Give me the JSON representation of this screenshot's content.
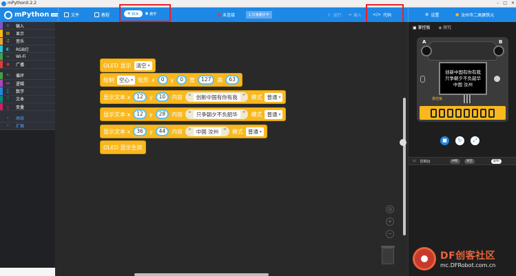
{
  "window": {
    "title": "mPython0.2.2",
    "controls": [
      "–",
      "□",
      "✕"
    ]
  },
  "toolbar": {
    "app_name": "mPython",
    "app_tag": "beta",
    "file": "文件",
    "tutorial": "教程",
    "mode_blocks": "积木",
    "mode_teach": "教学",
    "status": "未连接",
    "device": "1.只争朝夕不",
    "run": "运行",
    "import": "插入",
    "code": "代码",
    "settings": "设置",
    "account": "汝州市二高建筑元"
  },
  "sidebar": {
    "categories": [
      {
        "label": "输入",
        "color": "#7e57c2",
        "icon": "⊕"
      },
      {
        "label": "显示",
        "color": "#f9b81d",
        "icon": "▤"
      },
      {
        "label": "音乐",
        "color": "#e9a23b",
        "icon": "♫"
      },
      {
        "label": "RGB灯",
        "color": "#26c6da",
        "icon": "◐"
      },
      {
        "label": "Wi-Fi",
        "color": "#43a047",
        "icon": "≈"
      },
      {
        "label": "广播",
        "color": "#e53935",
        "icon": "◉"
      }
    ],
    "categories2": [
      {
        "label": "循环",
        "color": "#43a047",
        "icon": "↻"
      },
      {
        "label": "逻辑",
        "color": "#ab47bc",
        "icon": "⋈"
      },
      {
        "label": "数学",
        "color": "#1e88e5",
        "icon": "∑"
      },
      {
        "label": "文本",
        "color": "#00897b",
        "icon": "T"
      },
      {
        "label": "变量",
        "color": "#d81b60",
        "icon": "χ"
      }
    ],
    "extras": [
      "高级",
      "扩展"
    ]
  },
  "blocks": {
    "b1": {
      "label": "OLED 显示",
      "dropdown": "清空"
    },
    "b2": {
      "label": "绘制",
      "dropdown": "空心",
      "shape": "矩形",
      "x_label": "x",
      "x": "0",
      "y_label": "y",
      "y": "0",
      "w_label": "宽",
      "w": "127",
      "h_label": "高",
      "h": "63"
    },
    "b3": {
      "label": "显示文本 x",
      "x": "12",
      "y_label": "y",
      "y": "10",
      "content_label": "内容",
      "text": "创新中国有你有我",
      "mode_label": "模式",
      "mode": "普通"
    },
    "b4": {
      "label": "显示文本 x",
      "x": "12",
      "y_label": "y",
      "y": "28",
      "content_label": "内容",
      "text": "只争朝夕不负韶华",
      "mode_label": "模式",
      "mode": "普通"
    },
    "b5": {
      "label": "显示文本 x",
      "x": "36",
      "y_label": "y",
      "y": "44",
      "content_label": "内容",
      "text": "中国 汝州",
      "mode_label": "模式",
      "mode": "普通"
    },
    "b6": {
      "label": "OLED 显示生效"
    },
    "quote_open": "“",
    "quote_close": "”"
  },
  "right_panel": {
    "tab_board": "掌控板",
    "tab_explore": "探究",
    "btn_a": "A",
    "btn_b": "B",
    "oled_lines": [
      "创新中国有你有我",
      "只争朝夕不负韶华",
      "中国 汝州"
    ],
    "brand": "掌控板",
    "console_label": "控制台",
    "console_opts": [
      "中断",
      "清空",
      "复制"
    ]
  },
  "watermark": {
    "title": "DF创客社区",
    "url": "mc.DFRobot.com.cn"
  },
  "colors": {
    "toolbar": "#1d88e6",
    "block": "#f9b81d",
    "highlight": "#e8202a",
    "workspace": "#292929"
  }
}
